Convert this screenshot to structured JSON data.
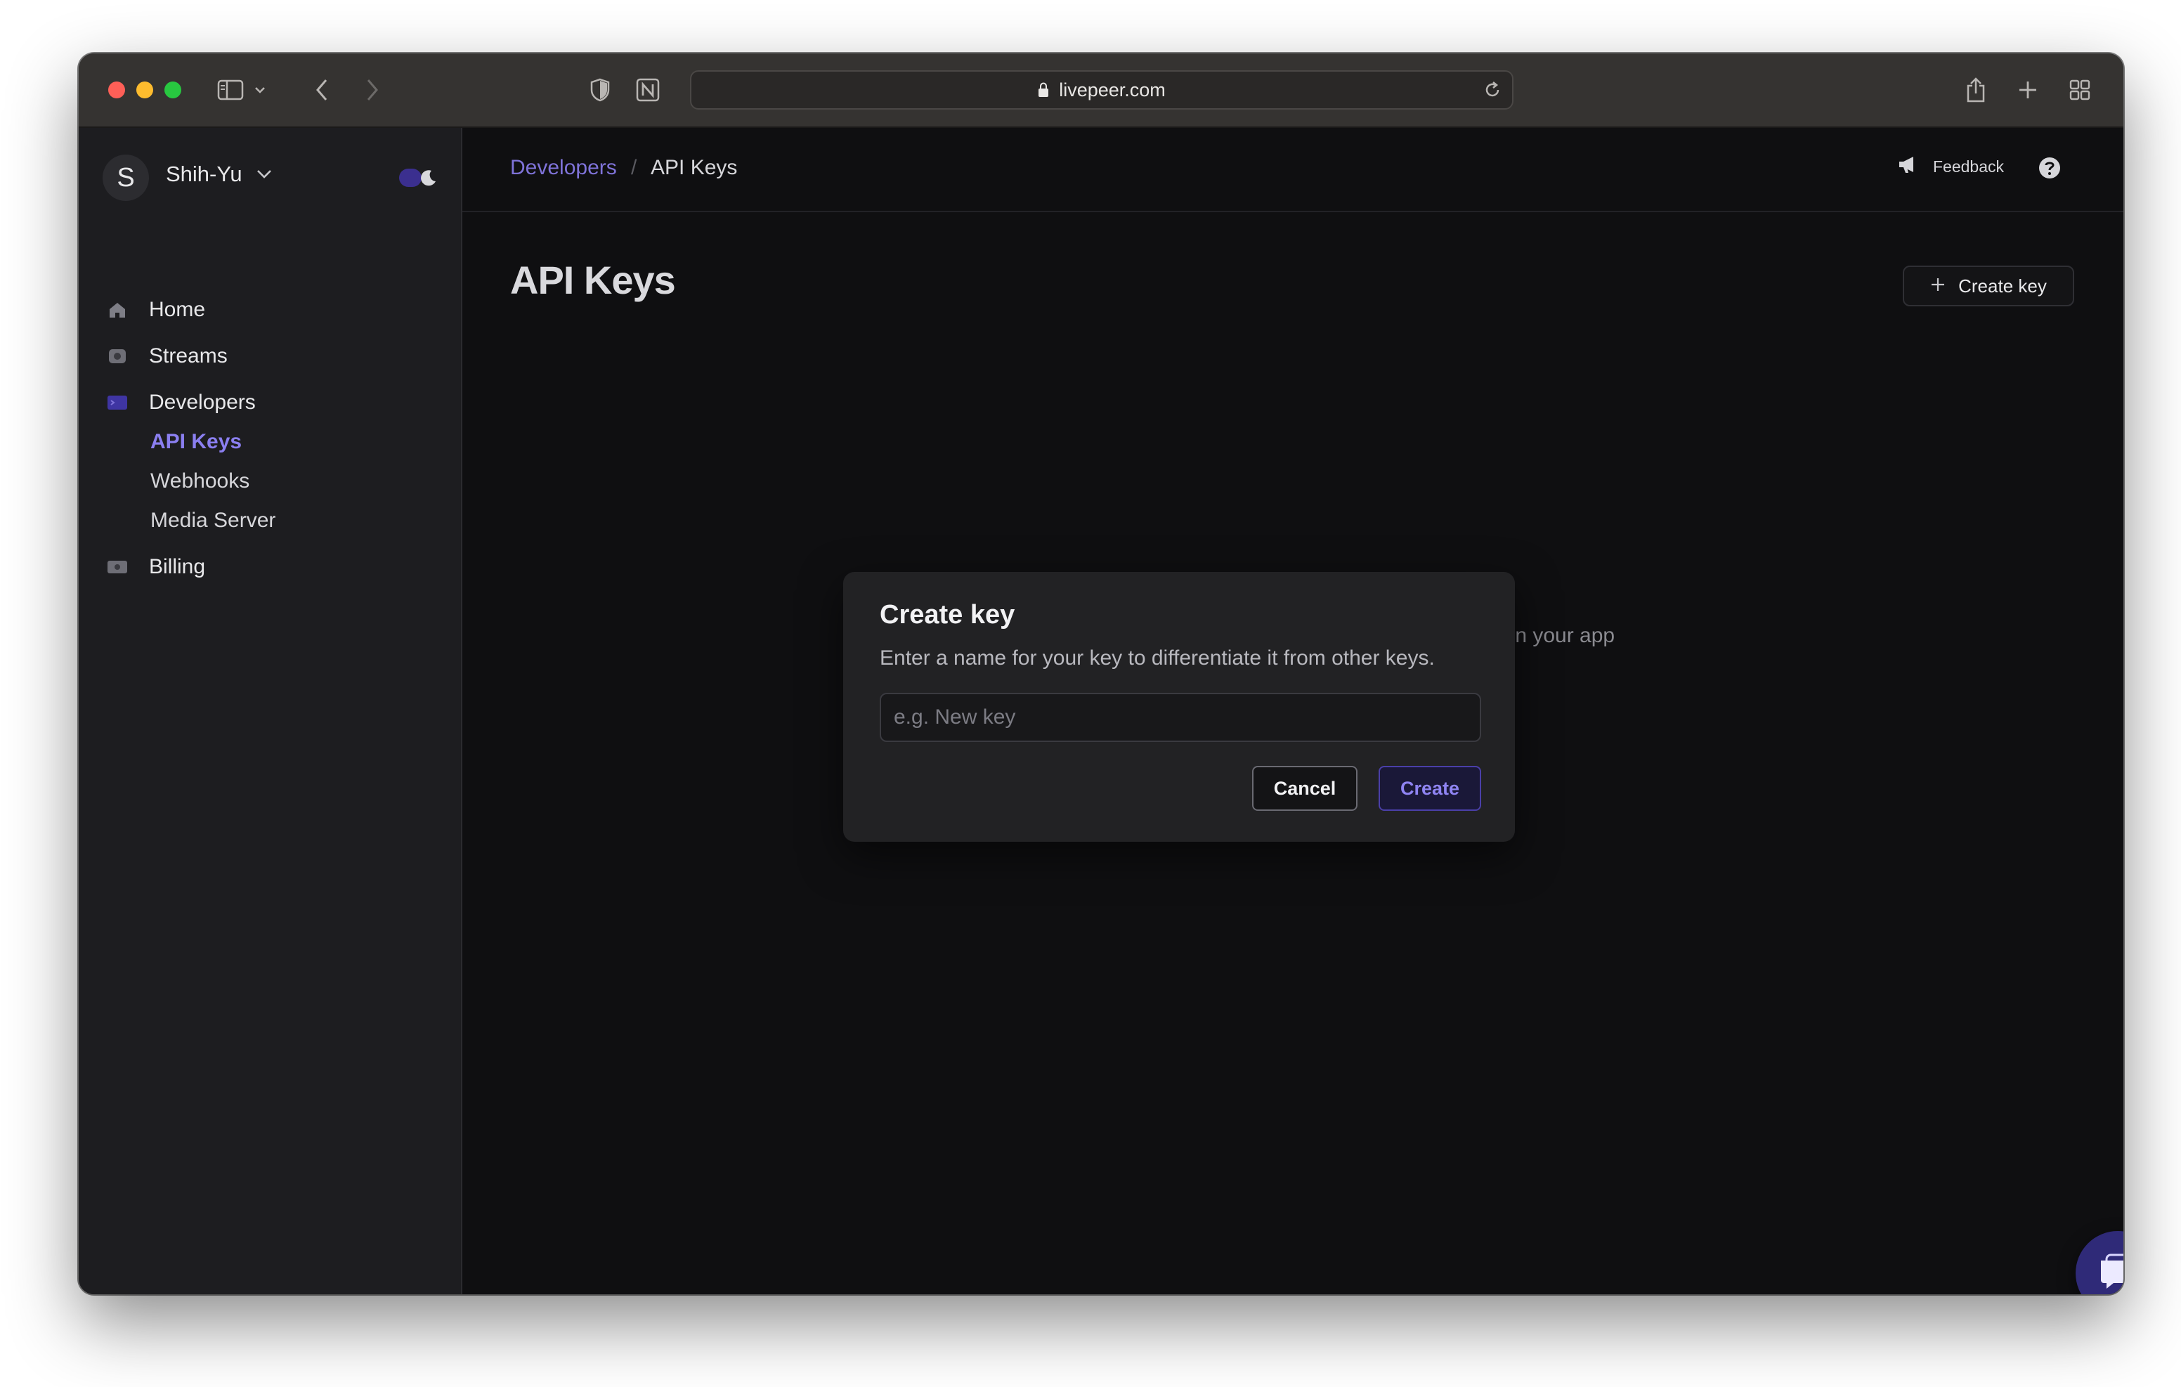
{
  "browser": {
    "url": "livepeer.com"
  },
  "sidebar": {
    "avatar_initial": "S",
    "username": "Shih-Yu",
    "nav": [
      {
        "label": "Home",
        "icon": "home-icon"
      },
      {
        "label": "Streams",
        "icon": "streams-icon"
      },
      {
        "label": "Developers",
        "icon": "developers-icon"
      },
      {
        "label": "Billing",
        "icon": "billing-icon"
      }
    ],
    "developers_sub": [
      {
        "label": "API Keys",
        "active": true
      },
      {
        "label": "Webhooks",
        "active": false
      },
      {
        "label": "Media Server",
        "active": false
      }
    ]
  },
  "header": {
    "breadcrumb_parent": "Developers",
    "breadcrumb_sep": "/",
    "breadcrumb_current": "API Keys",
    "feedback_label": "Feedback"
  },
  "main": {
    "title": "API Keys",
    "create_key_label": "Create key",
    "empty_hint_fragment": "ts in your app"
  },
  "modal": {
    "title": "Create key",
    "description": "Enter a name for your key to differentiate it from other keys.",
    "input_placeholder": "e.g. New key",
    "input_value": "",
    "cancel_label": "Cancel",
    "create_label": "Create"
  },
  "colors": {
    "accent": "#8b7ff0",
    "chat_bubble": "#2f2a78"
  }
}
